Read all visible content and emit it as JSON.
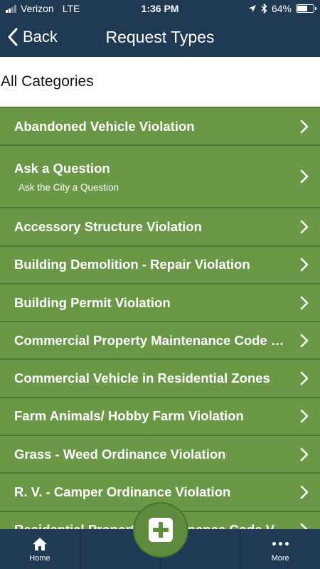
{
  "status_bar": {
    "carrier": "Verizon",
    "network": "LTE",
    "time": "1:36 PM",
    "battery": "64%",
    "battery_level": 0.64,
    "icons": [
      "signal-icon",
      "location-arrow-icon",
      "bluetooth-icon",
      "battery-icon"
    ]
  },
  "nav": {
    "back_label": "Back",
    "title": "Request Types"
  },
  "section": {
    "title": "All Categories"
  },
  "list": {
    "items": [
      {
        "title": "Abandoned Vehicle Violation",
        "subtitle": ""
      },
      {
        "title": "Ask a Question",
        "subtitle": "Ask the City a Question"
      },
      {
        "title": "Accessory Structure Violation",
        "subtitle": ""
      },
      {
        "title": "Building Demolition - Repair Violation",
        "subtitle": ""
      },
      {
        "title": "Building Permit Violation",
        "subtitle": ""
      },
      {
        "title": "Commercial Property Maintenance Code Violation",
        "subtitle": ""
      },
      {
        "title": "Commercial Vehicle in Residential Zones",
        "subtitle": ""
      },
      {
        "title": "Farm Animals/ Hobby Farm Violation",
        "subtitle": ""
      },
      {
        "title": "Grass - Weed Ordinance Violation",
        "subtitle": ""
      },
      {
        "title": "R. V. - Camper Ordinance Violation",
        "subtitle": ""
      },
      {
        "title": "Residential Property Maintenance Code Violation",
        "subtitle": ""
      }
    ]
  },
  "tabbar": {
    "home_label": "Home",
    "more_label": "More",
    "add_icon": "plus-icon"
  },
  "colors": {
    "header_bg": "#1f3a52",
    "row_bg": "#6a9847",
    "row_border": "#4f7834",
    "fab_bg": "#5f8c3e"
  }
}
